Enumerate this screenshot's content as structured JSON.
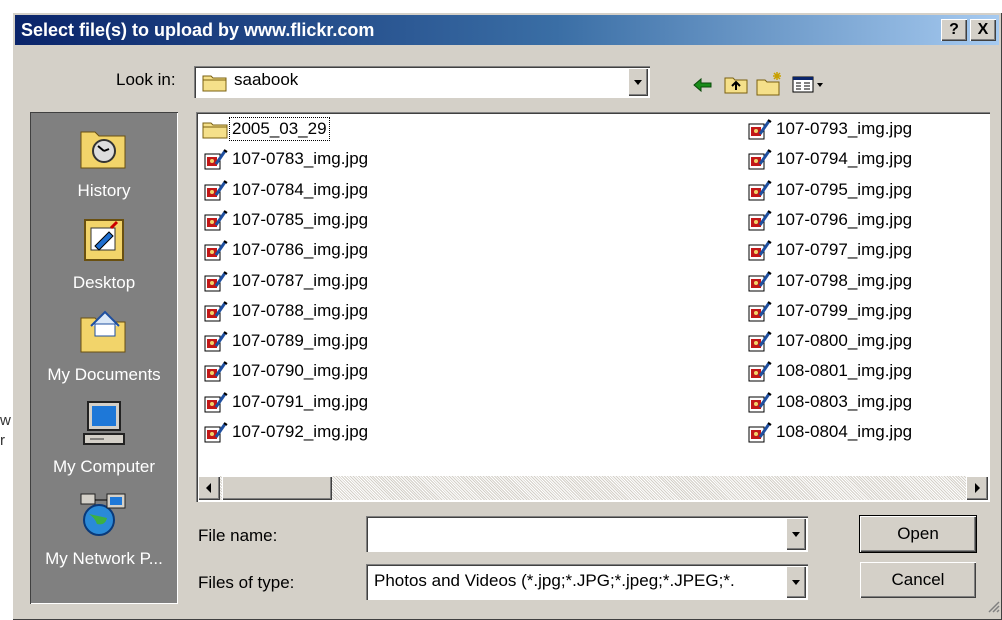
{
  "dialog": {
    "title": "Select file(s) to upload by www.flickr.com",
    "help_label": "?",
    "close_label": "X"
  },
  "look_in": {
    "label": "Look in:",
    "value": "saabook"
  },
  "places": [
    {
      "label": "History",
      "icon": "history-icon"
    },
    {
      "label": "Desktop",
      "icon": "desktop-icon"
    },
    {
      "label": "My Documents",
      "icon": "my-documents-icon"
    },
    {
      "label": "My Computer",
      "icon": "my-computer-icon"
    },
    {
      "label": "My Network P...",
      "icon": "my-network-places-icon"
    }
  ],
  "files": {
    "column1": [
      {
        "name": "2005_03_29",
        "type": "folder"
      },
      {
        "name": "107-0783_img.jpg",
        "type": "image"
      },
      {
        "name": "107-0784_img.jpg",
        "type": "image"
      },
      {
        "name": "107-0785_img.jpg",
        "type": "image"
      },
      {
        "name": "107-0786_img.jpg",
        "type": "image"
      },
      {
        "name": "107-0787_img.jpg",
        "type": "image"
      },
      {
        "name": "107-0788_img.jpg",
        "type": "image"
      },
      {
        "name": "107-0789_img.jpg",
        "type": "image"
      },
      {
        "name": "107-0790_img.jpg",
        "type": "image"
      },
      {
        "name": "107-0791_img.jpg",
        "type": "image"
      },
      {
        "name": "107-0792_img.jpg",
        "type": "image"
      }
    ],
    "column2": [
      {
        "name": "107-0793_img.jpg",
        "type": "image"
      },
      {
        "name": "107-0794_img.jpg",
        "type": "image"
      },
      {
        "name": "107-0795_img.jpg",
        "type": "image"
      },
      {
        "name": "107-0796_img.jpg",
        "type": "image"
      },
      {
        "name": "107-0797_img.jpg",
        "type": "image"
      },
      {
        "name": "107-0798_img.jpg",
        "type": "image"
      },
      {
        "name": "107-0799_img.jpg",
        "type": "image"
      },
      {
        "name": "107-0800_img.jpg",
        "type": "image"
      },
      {
        "name": "108-0801_img.jpg",
        "type": "image"
      },
      {
        "name": "108-0803_img.jpg",
        "type": "image"
      },
      {
        "name": "108-0804_img.jpg",
        "type": "image"
      }
    ]
  },
  "file_name": {
    "label": "File name:",
    "value": ""
  },
  "files_of_type": {
    "label": "Files of type:",
    "value": "Photos and Videos (*.jpg;*.JPG;*.jpeg;*.JPEG;*."
  },
  "buttons": {
    "open": "Open",
    "cancel": "Cancel"
  },
  "background": {
    "fragment_1": "w",
    "fragment_2": "r"
  },
  "colors": {
    "title_bar_start": "#0a246a",
    "title_bar_end": "#a6caf0",
    "dialog_face": "#d4d0c8",
    "places_bar": "#808080"
  }
}
